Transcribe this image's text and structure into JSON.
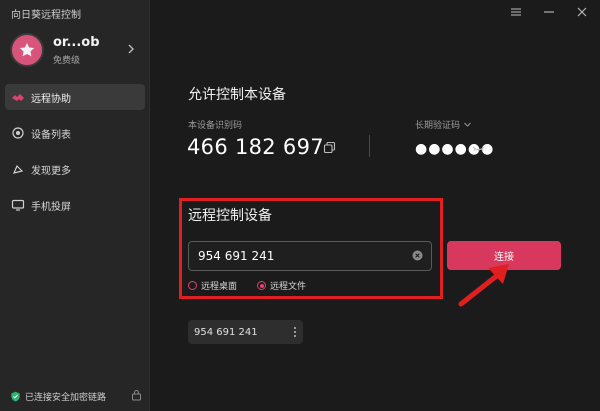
{
  "app": {
    "title": "向日葵远程控制"
  },
  "profile": {
    "name": "or...ob",
    "level": "免费级"
  },
  "nav": {
    "items": [
      {
        "label": "远程协助",
        "icon": "remote-assist-icon",
        "active": true
      },
      {
        "label": "设备列表",
        "icon": "device-list-icon",
        "active": false
      },
      {
        "label": "发现更多",
        "icon": "discover-icon",
        "active": false
      },
      {
        "label": "手机投屏",
        "icon": "screen-cast-icon",
        "active": false
      }
    ]
  },
  "status": {
    "security_text": "已连接安全加密链路"
  },
  "allow": {
    "heading": "允许控制本设备",
    "id_label": "本设备识别码",
    "device_id": "466 182 697",
    "code_label": "长期验证码",
    "code_masked": "●●●●●●"
  },
  "remote": {
    "heading": "远程控制设备",
    "input_value": "954 691 241",
    "options": [
      {
        "label": "远程桌面",
        "checked": false
      },
      {
        "label": "远程文件",
        "checked": true
      }
    ],
    "connect_label": "连接"
  },
  "history": {
    "items": [
      "954 691 241"
    ]
  },
  "colors": {
    "accent": "#d9385e",
    "highlight": "#e02020",
    "background": "#1b1b1b",
    "sidebar": "#262626"
  }
}
